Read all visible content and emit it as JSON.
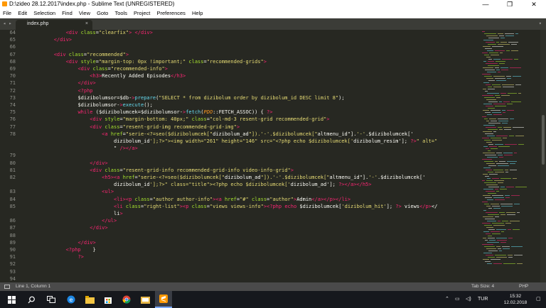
{
  "window": {
    "title": "D:\\zideo 28.12.2017\\index.php - Sublime Text (UNREGISTERED)",
    "controls": [
      "—",
      "❐",
      "✕"
    ]
  },
  "menu": [
    "File",
    "Edit",
    "Selection",
    "Find",
    "View",
    "Goto",
    "Tools",
    "Project",
    "Preferences",
    "Help"
  ],
  "tabs": [
    {
      "label": "index.php",
      "close": "×"
    }
  ],
  "line_numbers": [
    "64",
    "65",
    "66",
    "67",
    "68",
    "69",
    "70",
    "71",
    "72",
    "73",
    "74",
    "75",
    "76",
    "77",
    "78",
    "",
    "",
    "79",
    "80",
    "81",
    "82",
    "",
    "83",
    "84",
    "85",
    "",
    "86",
    "87",
    "88",
    "89",
    "90",
    "91",
    "92",
    "93",
    "94"
  ],
  "code_lines": [
    "            <div class=\"clearfix\"> </div>",
    "        </div>",
    "",
    "        <div class=\"recommended\">",
    "            <div style=\"margin-top: 0px !important;\" class=\"recommended-grids\">",
    "                <div class=\"recommended-info\">",
    "                    <h3>Recently Added Episodes</h3>",
    "                </div>",
    "                <?php",
    "                $dizibolumsor=$db->prepare(\"SELECT * from dizibolum order by dizibolum_id DESC limit 8\");",
    "                $dizibolumsor->execute();",
    "                while ($dizibolumcek=$dizibolumsor->fetch(PDO::FETCH_ASSOC)) { ?>",
    "                    <div style=\"margin-bottom: 40px;\" class=\"col-md-3 resent-grid recommended-grid\">",
    "                    <div class=\"resent-grid-img recommended-grid-img\">",
    "                        <a href=\"serie-<?=seo($dizibolumcek[\"dizibolum_ad\"]).'-'.$dizibolumcek[\"altmenu_id\"].'-'.$dizibolumcek['",
    "                            dizibolum_id'];?>\"><img width=\"261\" height=\"146\" src=\"<?php echo $dizibolumcek['dizibolum_resim']; ?>\" alt=\"",
    "                            \" /></a>",
    "",
    "                    </div>",
    "                    <div class=\"resent-grid-info recommended-grid-info video-info-grid\">",
    "                        <h5><a href=\"serie-<?=seo($dizibolumcek[\"dizibolum_ad\"]).'-'.$dizibolumcek[\"altmenu_id\"].'-'.$dizibolumcek['",
    "                            dizibolum_id'];?>\" class=\"title\"><?php echo $dizibolumcek['dizibolum_ad']; ?></a></h5>",
    "                        <ul>",
    "                            <li><p class=\"author author-info\"><a href=\"#\" class=\"author\">Admin</a></p></li>",
    "                            <li class=\"right-list\"><p class=\"views views-info\"><?php echo $dizibolumcek['dizibolum_hit']; ?> views</p></",
    "                            li>",
    "                        </ul>",
    "                    </div>",
    "",
    "                </div>",
    "            <?php    }",
    "                ?>",
    "",
    "",
    ""
  ],
  "status": {
    "position": "Line 1, Column 1",
    "tab_size": "Tab Size: 4",
    "syntax": "PHP"
  },
  "taskbar": {
    "icons": [
      "windows-logo-icon",
      "search-icon",
      "task-view-icon",
      "edge-icon",
      "file-explorer-icon",
      "store-icon",
      "chrome-icon",
      "explorer-icon",
      "sublime-icon"
    ],
    "language": "TUR",
    "time": "15:32",
    "date": "12.02.2018"
  },
  "colors": {
    "background": "#272822",
    "tag": "#f92672",
    "attribute": "#a6e22e",
    "string": "#e6db74",
    "function": "#66d9ef",
    "variable": "#f8f8f2"
  }
}
